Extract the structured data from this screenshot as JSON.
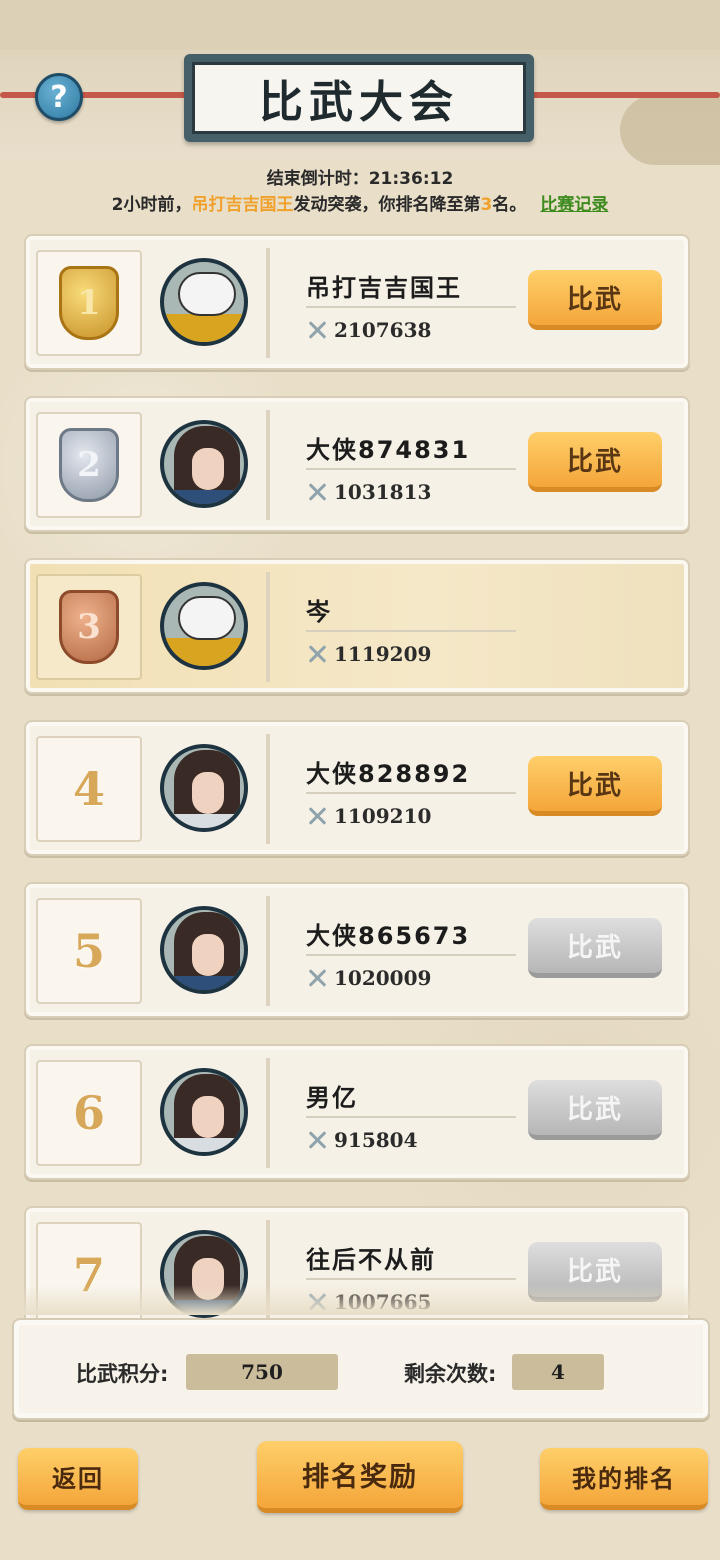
{
  "header": {
    "title": "比武大会",
    "help_label": "?"
  },
  "countdown": "结束倒计时：21:36:12",
  "notice": {
    "prefix": "2小时前，",
    "attacker": "吊打吉吉国王",
    "middle": "发动突袭，你排名降至第",
    "rank": "3",
    "suffix": "名。",
    "record_link": "比赛记录"
  },
  "ranking": [
    {
      "rank": "1",
      "medal": "gold",
      "avatar": "panda",
      "name": "吊打吉吉国王",
      "power": "2107638",
      "button": "比武",
      "button_state": "active"
    },
    {
      "rank": "2",
      "medal": "silver",
      "avatar": "female",
      "name": "大侠874831",
      "power": "1031813",
      "button": "比武",
      "button_state": "active"
    },
    {
      "rank": "3",
      "medal": "bronze",
      "avatar": "panda",
      "name": "岑",
      "power": "1119209",
      "button": "",
      "button_state": "self"
    },
    {
      "rank": "4",
      "medal": "none",
      "avatar": "male",
      "name": "大侠828892",
      "power": "1109210",
      "button": "比武",
      "button_state": "active"
    },
    {
      "rank": "5",
      "medal": "none",
      "avatar": "female",
      "name": "大侠865673",
      "power": "1020009",
      "button": "比武",
      "button_state": "disabled"
    },
    {
      "rank": "6",
      "medal": "none",
      "avatar": "male",
      "name": "男亿",
      "power": "915804",
      "button": "比武",
      "button_state": "disabled"
    },
    {
      "rank": "7",
      "medal": "none",
      "avatar": "female",
      "name": "往后不从前",
      "power": "1007665",
      "button": "比武",
      "button_state": "disabled"
    }
  ],
  "stats": {
    "points_label": "比武积分:",
    "points_value": "750",
    "remaining_label": "剩余次数:",
    "remaining_value": "4"
  },
  "footer": {
    "back": "返回",
    "rewards": "排名奖励",
    "my_rank": "我的排名"
  },
  "colors": {
    "accent_orange": "#f4a63a",
    "highlight_text": "#f0a12c",
    "link_green": "#3d8a1e",
    "disabled_gray": "#b6b6b6"
  }
}
